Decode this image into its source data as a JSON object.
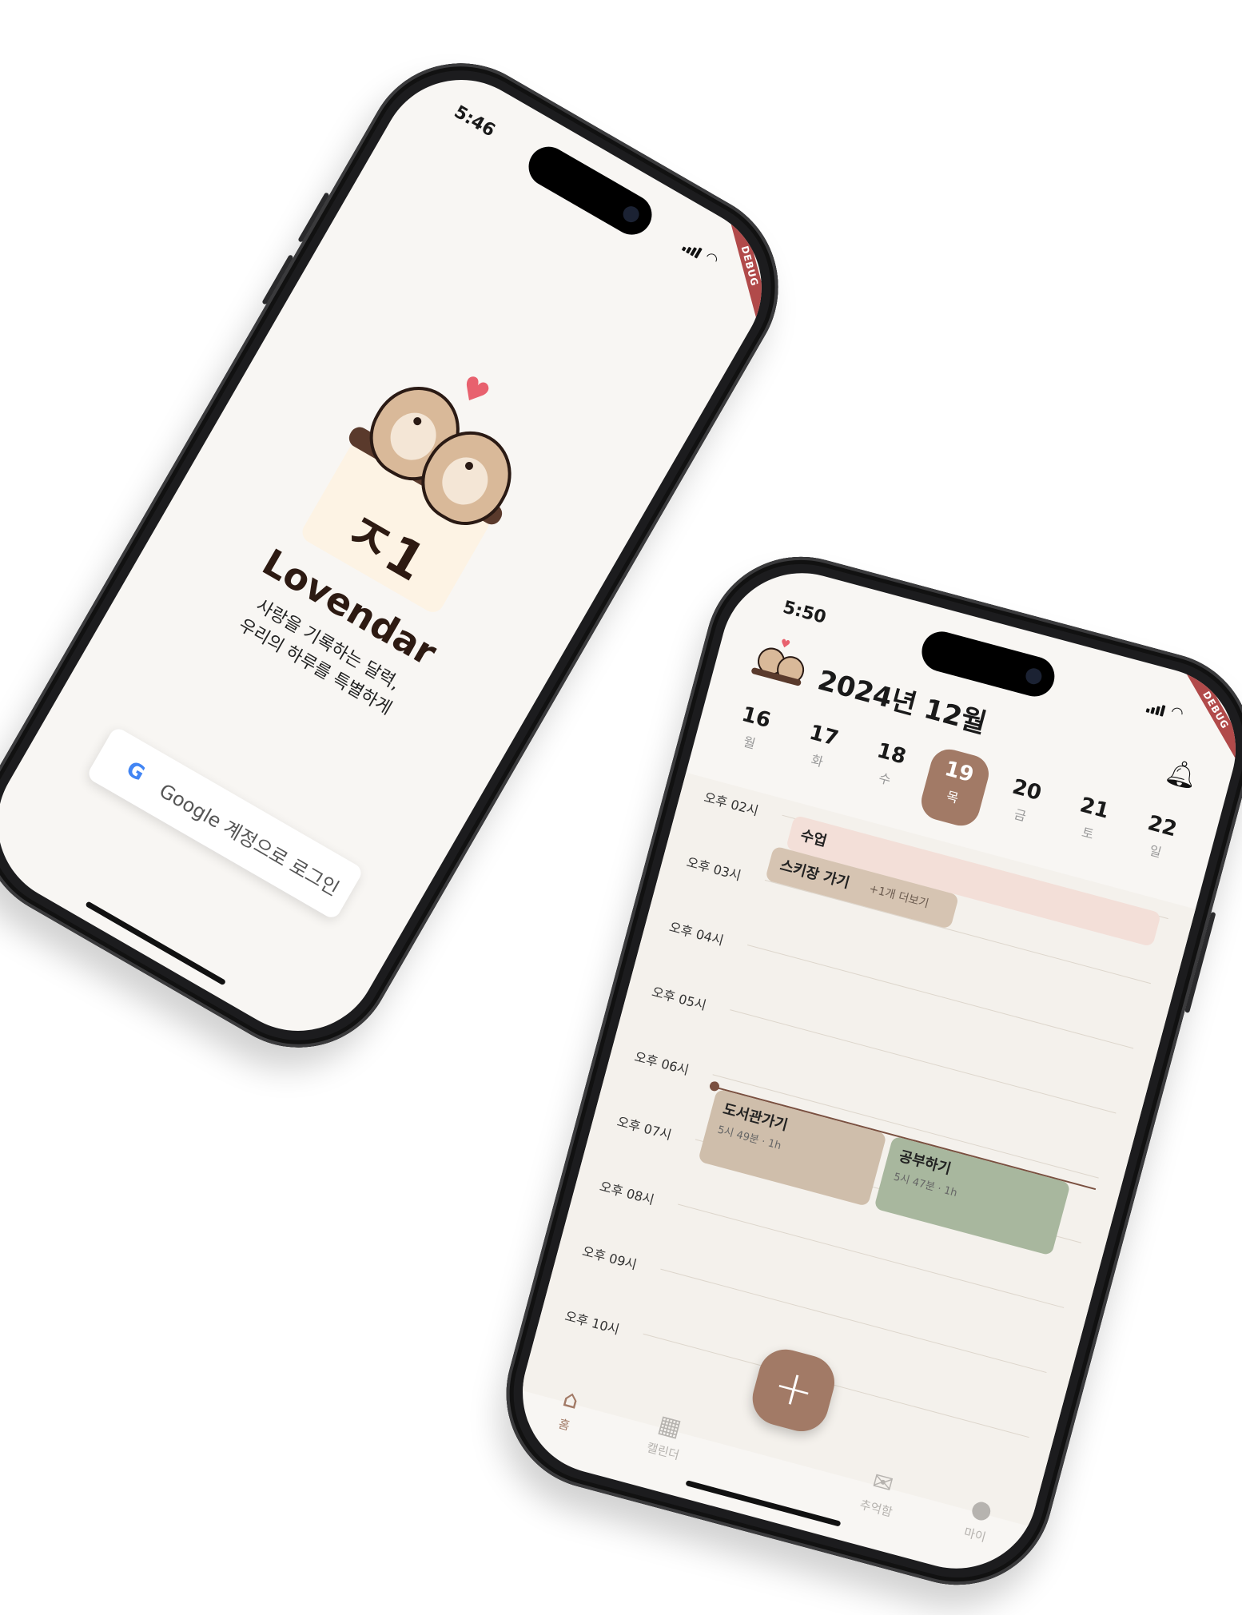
{
  "splash": {
    "status_time": "5:46",
    "debug_banner": "DEBUG",
    "heart_icon": "heart-icon",
    "logo_mark": "ㅈ1",
    "brand": "Lovendar",
    "tagline_line1": "사랑을 기록하는 달력,",
    "tagline_line2": "우리의 하루를 특별하게",
    "google_logo": "G",
    "google_button": "Google 계정으로 로그인"
  },
  "calendar": {
    "status_time": "5:50",
    "debug_banner": "DEBUG",
    "month_title": "2024년 12월",
    "week": [
      {
        "num": "16",
        "wd": "월"
      },
      {
        "num": "17",
        "wd": "화"
      },
      {
        "num": "18",
        "wd": "수"
      },
      {
        "num": "19",
        "wd": "목"
      },
      {
        "num": "20",
        "wd": "금"
      },
      {
        "num": "21",
        "wd": "토"
      },
      {
        "num": "22",
        "wd": "일"
      }
    ],
    "selected_day": "19",
    "hours": [
      "오후 02시",
      "오후 03시",
      "오후 04시",
      "오후 05시",
      "오후 06시",
      "오후 07시",
      "오후 08시",
      "오후 09시",
      "오후 10시"
    ],
    "events": {
      "class": {
        "title": "수업"
      },
      "ski": {
        "title": "스키장 가기",
        "more": "+1개 더보기"
      },
      "library": {
        "title": "도서관가기",
        "meta": "5시 49분 · 1h"
      },
      "study": {
        "title": "공부하기",
        "meta": "5시 47분 · 1h"
      }
    },
    "fab_label": "+",
    "tabs": [
      {
        "label": "홈",
        "icon": "home-icon"
      },
      {
        "label": "캘린더",
        "icon": "calendar-icon"
      },
      {
        "label": "추억함",
        "icon": "memory-box-icon"
      },
      {
        "label": "마이",
        "icon": "person-icon"
      }
    ],
    "colors": {
      "accent": "#a27a66",
      "class_event": "#f3dfd8",
      "ski_event": "#d6c4b2",
      "library_event": "#cfbeab",
      "study_event": "#a8b79e"
    }
  }
}
